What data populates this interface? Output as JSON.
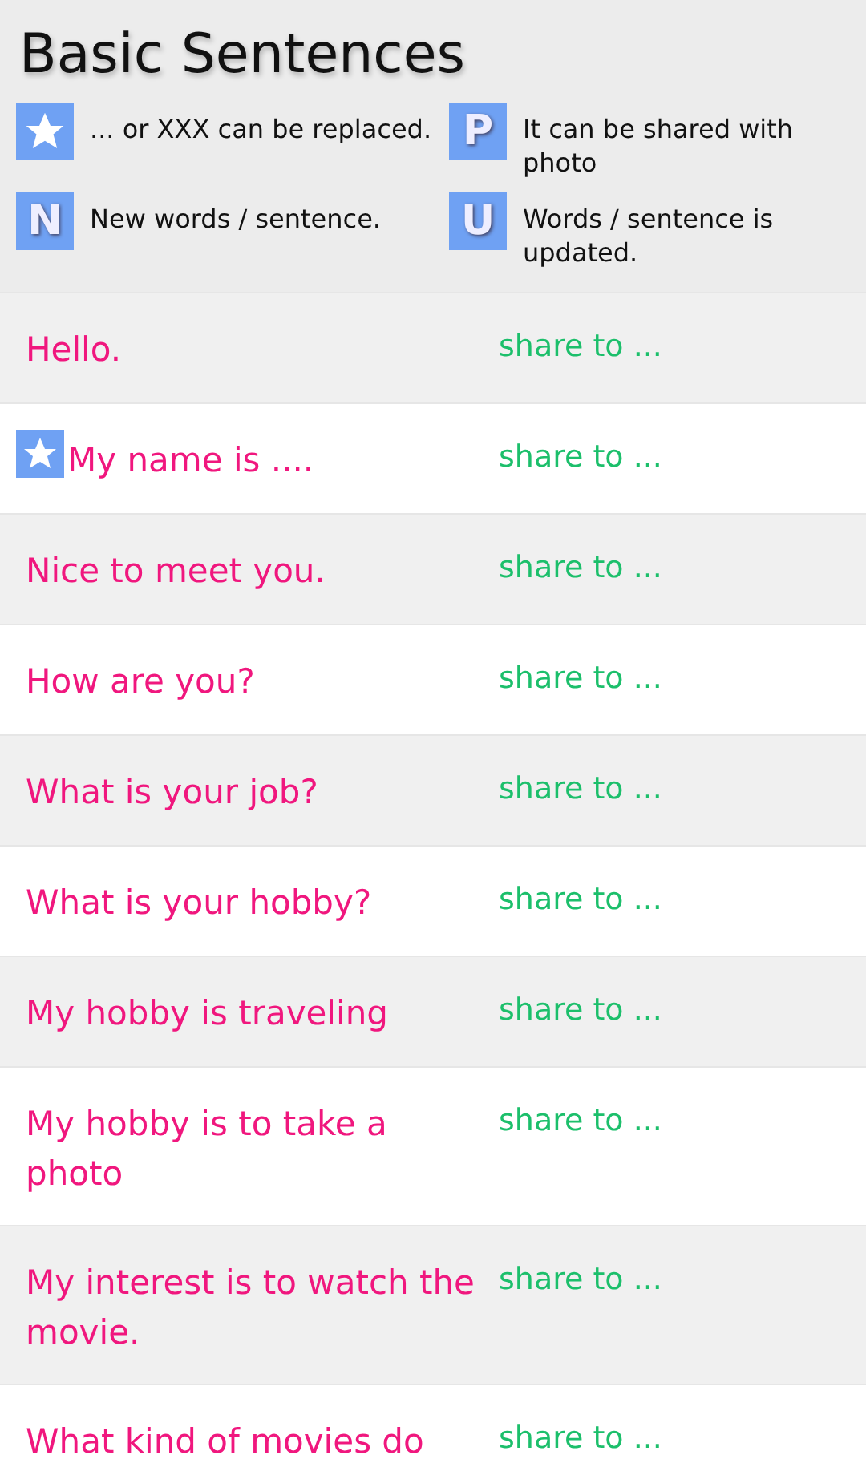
{
  "title": "Basic Sentences",
  "legend": [
    {
      "kind": "star",
      "text": "... or XXX can be replaced."
    },
    {
      "kind": "letter",
      "letter": "P",
      "text": "It can be shared with photo"
    },
    {
      "kind": "letter",
      "letter": "N",
      "text": "New words / sentence."
    },
    {
      "kind": "letter",
      "letter": "U",
      "text": "Words / sentence is updated."
    }
  ],
  "rows": [
    {
      "kind": "plain",
      "sentence": "Hello.",
      "share": "share to ..."
    },
    {
      "kind": "starred",
      "sentence": "My name is ....",
      "share": "share to ..."
    },
    {
      "kind": "plain",
      "sentence": "Nice to meet you.",
      "share": "share to ..."
    },
    {
      "kind": "plain",
      "sentence": "How are you?",
      "share": "share to ..."
    },
    {
      "kind": "plain",
      "sentence": "What is your job?",
      "share": "share to ..."
    },
    {
      "kind": "plain",
      "sentence": "What is your hobby?",
      "share": "share to ..."
    },
    {
      "kind": "plain",
      "sentence": "My hobby is traveling",
      "share": "share to ..."
    },
    {
      "kind": "plain",
      "sentence": "My hobby is to take a photo",
      "share": "share to ..."
    },
    {
      "kind": "plain",
      "sentence": "My interest is to watch the movie.",
      "share": "share to ..."
    },
    {
      "kind": "plain",
      "sentence": "What kind of movies do",
      "share": "share to ..."
    }
  ]
}
